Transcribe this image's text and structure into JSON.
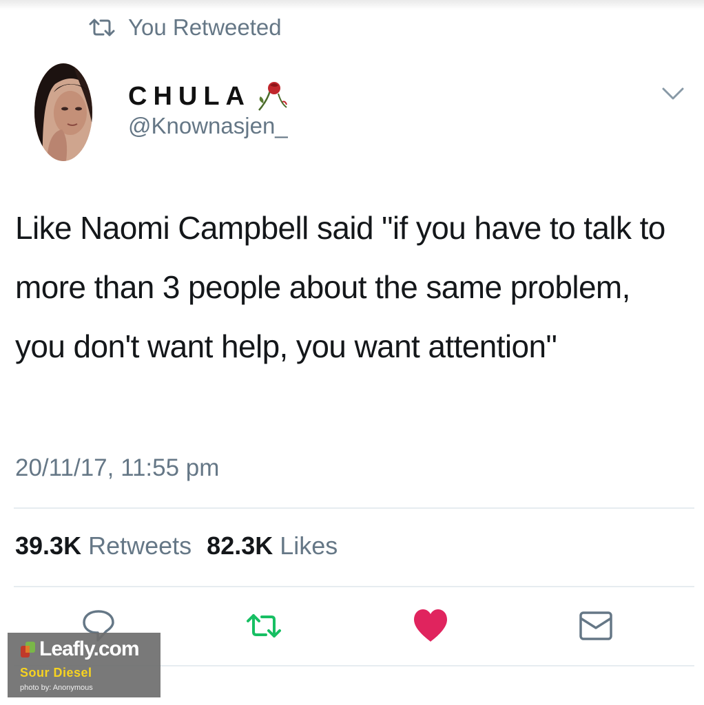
{
  "tweet": {
    "retweet_context": "You Retweeted",
    "author_name": "CHULA",
    "author_handle": "@Knownasjen_",
    "text": "Like Naomi Campbell said \"if you have to talk to more than 3 people about the same problem, you don't want help, you want attention\"",
    "timestamp": "20/11/17, 11:55 pm",
    "retweet_count": "39.3K",
    "retweet_label": "Retweets",
    "like_count": "82.3K",
    "like_label": "Likes"
  },
  "actions": {
    "reply_icon": "speech-bubble-icon",
    "retweet_icon": "retweet-arrows-icon",
    "like_icon": "heart-icon",
    "dm_icon": "envelope-icon"
  },
  "colors": {
    "retweet_active": "#17bf63",
    "like_active": "#e0245e",
    "secondary_text": "#657786"
  },
  "watermark": {
    "brand": "Leafly.com",
    "strain": "Sour Diesel",
    "credit": "photo by: Anonymous"
  }
}
